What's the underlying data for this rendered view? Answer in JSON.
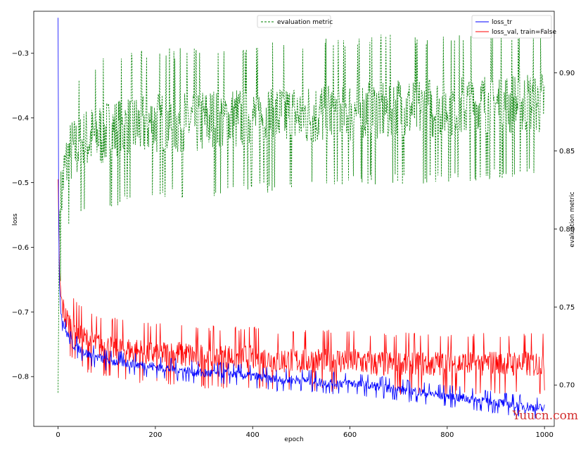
{
  "chart_data": {
    "type": "line",
    "xlabel": "epoch",
    "ylabel": "loss",
    "y2label": "evaluation metric",
    "xlim": [
      -50,
      1020
    ],
    "ylim": [
      -0.877,
      -0.235
    ],
    "y2lim": [
      0.6735,
      0.9395
    ],
    "xticks": [
      0,
      200,
      400,
      600,
      800,
      1000
    ],
    "yticks": [
      -0.8,
      -0.7,
      -0.6,
      -0.5,
      -0.4,
      -0.3
    ],
    "y2ticks": [
      0.7,
      0.75,
      0.8,
      0.85,
      0.9
    ],
    "grid": false,
    "legend_right": {
      "placement": "top-right",
      "entries": [
        "loss_tr",
        "loss_val, train=False"
      ]
    },
    "legend_left": {
      "placement": "top-center",
      "entries": [
        "evaluation metric"
      ]
    },
    "series": [
      {
        "name": "loss_tr",
        "axis": "left",
        "color": "#0000ff",
        "style": "solid",
        "x": [
          0,
          1,
          2,
          3,
          5,
          8,
          12,
          16,
          20,
          25,
          30,
          40,
          50,
          60,
          80,
          100,
          150,
          200,
          250,
          300,
          350,
          400,
          450,
          500,
          550,
          600,
          650,
          700,
          750,
          800,
          850,
          900,
          950,
          1000
        ],
        "values": [
          -0.245,
          -0.52,
          -0.62,
          -0.66,
          -0.69,
          -0.71,
          -0.72,
          -0.73,
          -0.735,
          -0.745,
          -0.75,
          -0.755,
          -0.76,
          -0.765,
          -0.77,
          -0.775,
          -0.78,
          -0.785,
          -0.79,
          -0.795,
          -0.795,
          -0.8,
          -0.805,
          -0.805,
          -0.81,
          -0.81,
          -0.815,
          -0.82,
          -0.825,
          -0.83,
          -0.835,
          -0.84,
          -0.845,
          -0.85
        ],
        "noise": 0.008
      },
      {
        "name": "loss_val, train=False",
        "axis": "left",
        "color": "#ff0000",
        "style": "solid",
        "x": [
          0,
          1,
          2,
          3,
          5,
          8,
          12,
          16,
          20,
          25,
          30,
          40,
          50,
          60,
          80,
          100,
          150,
          200,
          250,
          300,
          350,
          400,
          450,
          500,
          550,
          600,
          650,
          700,
          750,
          800,
          850,
          900,
          950,
          1000
        ],
        "values": [
          -0.495,
          -0.55,
          -0.6,
          -0.64,
          -0.67,
          -0.69,
          -0.7,
          -0.71,
          -0.715,
          -0.72,
          -0.725,
          -0.73,
          -0.74,
          -0.745,
          -0.75,
          -0.755,
          -0.76,
          -0.765,
          -0.765,
          -0.77,
          -0.77,
          -0.77,
          -0.775,
          -0.775,
          -0.775,
          -0.775,
          -0.78,
          -0.78,
          -0.78,
          -0.78,
          -0.78,
          -0.78,
          -0.78,
          -0.78
        ],
        "noise": 0.022
      },
      {
        "name": "evaluation metric",
        "axis": "right",
        "color": "#008000",
        "style": "dashed",
        "x": [
          0,
          1,
          2,
          3,
          5,
          8,
          12,
          16,
          20,
          25,
          30,
          40,
          50,
          60,
          80,
          100,
          150,
          200,
          250,
          300,
          350,
          400,
          450,
          500,
          550,
          600,
          650,
          700,
          750,
          800,
          850,
          900,
          950,
          1000
        ],
        "values": [
          0.695,
          0.74,
          0.79,
          0.81,
          0.815,
          0.825,
          0.835,
          0.84,
          0.845,
          0.848,
          0.85,
          0.852,
          0.855,
          0.857,
          0.86,
          0.862,
          0.865,
          0.868,
          0.868,
          0.869,
          0.87,
          0.871,
          0.872,
          0.873,
          0.874,
          0.875,
          0.876,
          0.877,
          0.877,
          0.878,
          0.879,
          0.88,
          0.88,
          0.881
        ],
        "noise": 0.022
      }
    ]
  },
  "watermark": "Yuucn.com"
}
